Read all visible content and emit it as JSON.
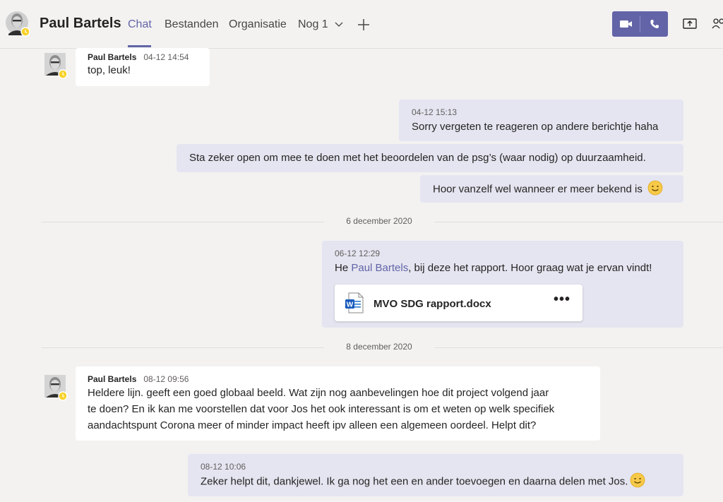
{
  "header": {
    "name": "Paul Bartels",
    "tabs": [
      {
        "label": "Chat",
        "active": true
      },
      {
        "label": "Bestanden"
      },
      {
        "label": "Organisatie"
      },
      {
        "label": "Nog 1"
      }
    ],
    "accent": "#6264a7",
    "icons": [
      "video-camera-icon",
      "phone-icon",
      "share-screen-icon",
      "add-people-icon",
      "plus-icon",
      "chevron-down-icon"
    ]
  },
  "messages": [
    {
      "sender": "Paul Bartels",
      "time": "04-12 14:54",
      "text": "top, leuk!"
    },
    {
      "time": "04-12 15:13",
      "text": "Sorry vergeten te reageren op andere berichtje haha"
    },
    {
      "text": "Sta zeker open om mee te doen met het beoordelen van de psg’s (waar nodig) op duurzaamheid."
    },
    {
      "text": "Hoor vanzelf wel wanneer er meer bekend is"
    },
    {
      "time": "06-12 12:29",
      "text_before": "He ",
      "mention": "Paul Bartels",
      "text_after": ", bij deze het rapport. Hoor graag wat je ervan vindt!",
      "file": "MVO SDG rapport.docx",
      "file_more": "•••"
    },
    {
      "sender": "Paul Bartels",
      "time": "08-12 09:56",
      "lines": [
        "Heldere lijn. geeft een goed globaal beeld. Wat zijn nog aanbevelingen hoe dit project volgend jaar",
        "te doen? En ik kan me voorstellen dat voor Jos het ook interessant is om et weten op welk specifiek",
        "aandachtspunt Corona meer of minder impact heeft ipv alleen een algemeen oordeel. Helpt dit?"
      ]
    },
    {
      "time": "08-12 10:06",
      "text": "Zeker helpt dit, dankjewel. Ik ga nog het een en ander toevoegen en  daarna delen met Jos."
    }
  ],
  "dividers": [
    "6 december 2020",
    "8 december 2020"
  ]
}
